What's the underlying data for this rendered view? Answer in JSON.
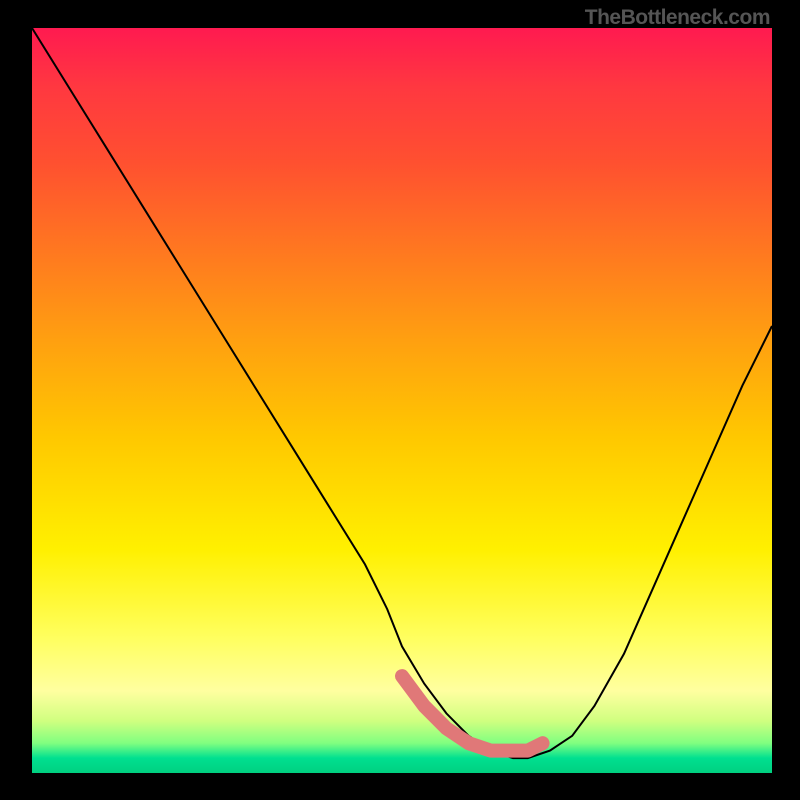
{
  "attribution": "TheBottleneck.com",
  "chart_data": {
    "type": "line",
    "title": "",
    "xlabel": "",
    "ylabel": "",
    "xlim": [
      0,
      100
    ],
    "ylim": [
      0,
      100
    ],
    "series": [
      {
        "name": "bottleneck-curve",
        "x": [
          0,
          5,
          10,
          15,
          20,
          25,
          30,
          35,
          40,
          45,
          48,
          50,
          53,
          56,
          59,
          62,
          65,
          67,
          70,
          73,
          76,
          80,
          84,
          88,
          92,
          96,
          100
        ],
        "values": [
          100,
          92,
          84,
          76,
          68,
          60,
          52,
          44,
          36,
          28,
          22,
          17,
          12,
          8,
          5,
          3,
          2,
          2,
          3,
          5,
          9,
          16,
          25,
          34,
          43,
          52,
          60
        ]
      }
    ],
    "marker_region": {
      "name": "optimal-range",
      "x": [
        50,
        53,
        56,
        59,
        62,
        65,
        67,
        69
      ],
      "values": [
        13,
        9,
        6,
        4,
        3,
        3,
        3,
        4
      ],
      "color": "#e07878"
    },
    "background_gradient": {
      "stops": [
        {
          "pos": 0.0,
          "color": "#ff1a50"
        },
        {
          "pos": 0.55,
          "color": "#ffe000"
        },
        {
          "pos": 0.9,
          "color": "#ffffa0"
        },
        {
          "pos": 1.0,
          "color": "#00d080"
        }
      ]
    }
  }
}
